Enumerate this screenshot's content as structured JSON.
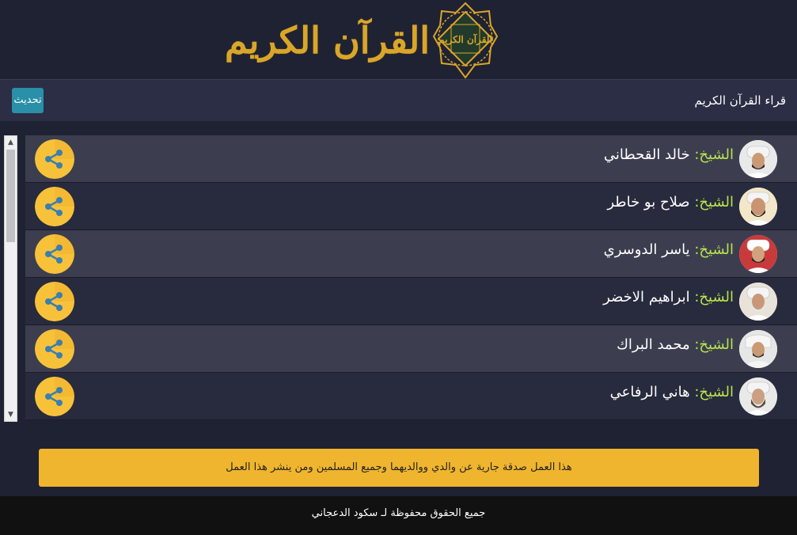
{
  "logo": {
    "text": "القرآن الكريم",
    "medallion_text": "القرآن الكريم"
  },
  "header": {
    "title": "قراء القرآن الكريم",
    "refresh_label": "تحديث"
  },
  "reciters": [
    {
      "prefix": "الشيخ:",
      "name": "خالد القحطاني"
    },
    {
      "prefix": "الشيخ:",
      "name": "صلاح بو خاطر"
    },
    {
      "prefix": "الشيخ:",
      "name": "ياسر الدوسري"
    },
    {
      "prefix": "الشيخ:",
      "name": "ابراهيم الاخضر"
    },
    {
      "prefix": "الشيخ:",
      "name": "محمد البراك"
    },
    {
      "prefix": "الشيخ:",
      "name": "هاني الرفاعي"
    }
  ],
  "icons": {
    "share": "share-icon",
    "scroll_up": "chevron-up-icon",
    "scroll_down": "chevron-down-icon"
  },
  "banner": {
    "text": "هذا العمل صدقة جارية عن والدي ووالديهما وجميع المسلمين ومن ينشر هذا العمل"
  },
  "footer": {
    "text": "جميع الحقوق محفوظة لـ سكود الدعجاني"
  },
  "colors": {
    "background": "#1f2233",
    "header_bar": "#2b2e44",
    "row_light": "#3c3e50",
    "row_dark": "#282a3d",
    "prefix": "#b9e34c",
    "share": "#f7c23a",
    "banner": "#f0b52e",
    "refresh": "#2a8fa8",
    "logo_gold": "#d9a62a"
  }
}
